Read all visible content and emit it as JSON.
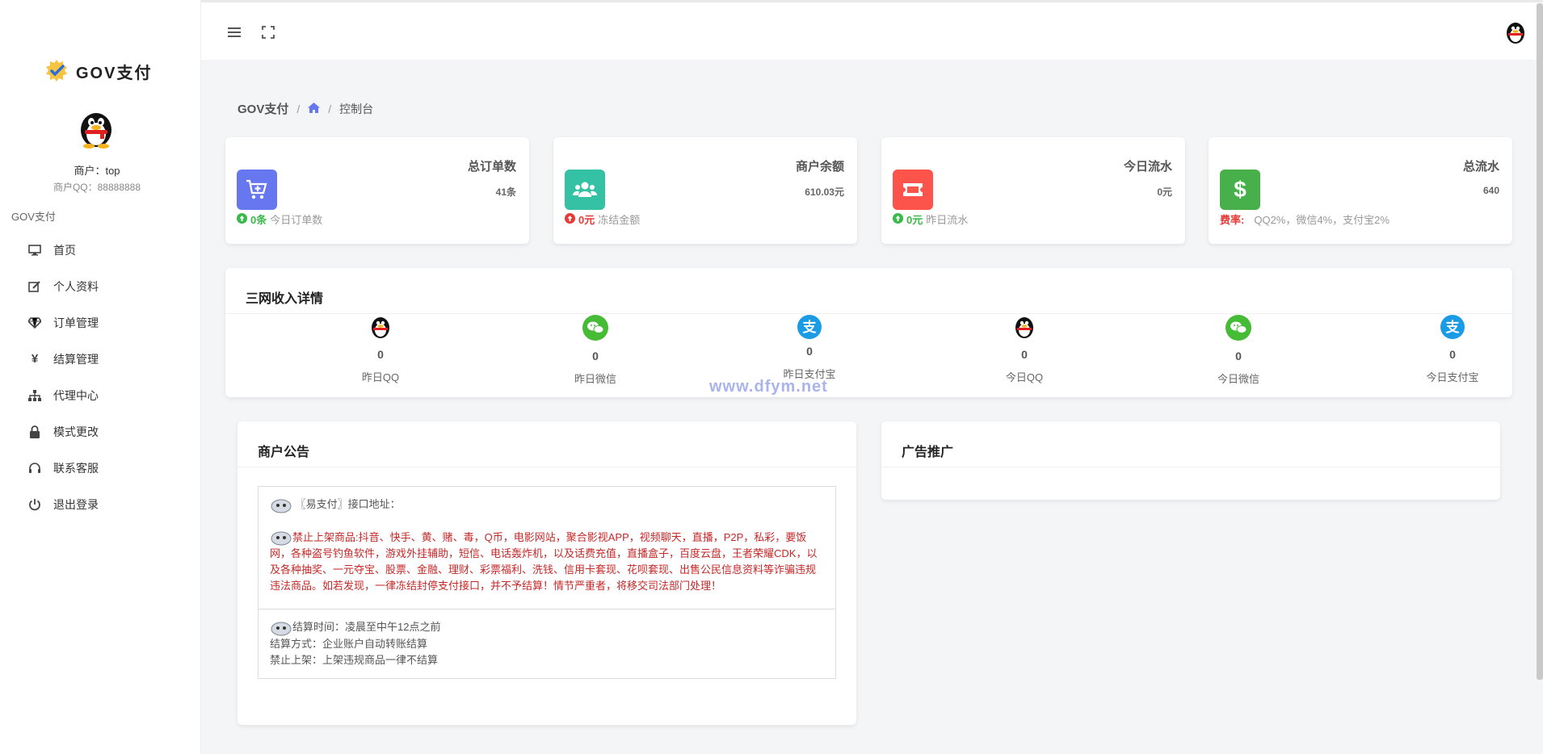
{
  "brand": {
    "name": "GOV支付"
  },
  "user": {
    "merchant_label": "商户：top",
    "qq_label": "商户QQ：88888888"
  },
  "nav": {
    "section": "GOV支付",
    "items": [
      {
        "label": "首页",
        "icon": "monitor-icon"
      },
      {
        "label": "个人资料",
        "icon": "edit-icon"
      },
      {
        "label": "订单管理",
        "icon": "diamond-icon"
      },
      {
        "label": "结算管理",
        "icon": "yen-icon"
      },
      {
        "label": "代理中心",
        "icon": "sitemap-icon"
      },
      {
        "label": "模式更改",
        "icon": "lock-icon"
      },
      {
        "label": "联系客服",
        "icon": "headset-icon"
      },
      {
        "label": "退出登录",
        "icon": "power-icon"
      }
    ]
  },
  "topbar": {
    "menu_icon": "hamburger-icon",
    "fullscreen_icon": "fullscreen-icon",
    "avatar_icon": "qq-penguin-icon"
  },
  "breadcrumb": {
    "root": "GOV支付",
    "sep1": "/",
    "home_icon": "home-icon",
    "sep2": "/",
    "current": "控制台"
  },
  "stats": [
    {
      "title": "总订单数",
      "value": "41条",
      "foot_value": "0条",
      "foot_label": "今日订单数",
      "foot_color": "green",
      "icon": "cart-add-icon",
      "color": "#6777ef"
    },
    {
      "title": "商户余额",
      "value": "610.03元",
      "foot_value": "0元",
      "foot_label": "冻结金额",
      "foot_color": "red",
      "icon": "users-icon",
      "color": "#35c2a4"
    },
    {
      "title": "今日流水",
      "value": "0元",
      "foot_value": "0元",
      "foot_label": "昨日流水",
      "foot_color": "green",
      "icon": "ticket-icon",
      "color": "#fc544b"
    },
    {
      "title": "总流水",
      "value": "640",
      "foot_value": "费率:",
      "foot_label": "QQ2%，微信4%，支付宝2%",
      "foot_color": "red",
      "icon": "dollar-icon",
      "color": "#47b04b"
    }
  ],
  "income": {
    "title": "三网收入详情",
    "items": [
      {
        "label": "昨日QQ",
        "value": "0",
        "icon": "qq-icon"
      },
      {
        "label": "昨日微信",
        "value": "0",
        "icon": "wechat-icon"
      },
      {
        "label": "昨日支付宝",
        "value": "0",
        "icon": "alipay-icon"
      },
      {
        "label": "今日QQ",
        "value": "0",
        "icon": "qq-icon"
      },
      {
        "label": "今日微信",
        "value": "0",
        "icon": "wechat-icon"
      },
      {
        "label": "今日支付宝",
        "value": "0",
        "icon": "alipay-icon"
      }
    ]
  },
  "notice": {
    "title": "商户公告",
    "line1": "〖易支付〗接口地址：",
    "line2": "禁止上架商品:抖音、快手、黄、赌、毒，Q币，电影网站，聚合影视APP，视频聊天，直播，P2P，私彩，要饭网，各种盗号钓鱼软件，游戏外挂辅助，短信、电话轰炸机，以及话费充值，直播盒子，百度云盘，王者荣耀CDK，以及各种抽奖、一元夺宝、股票、金融、理财、彩票福利、洗钱、信用卡套现、花呗套现、出售公民信息资料等诈骗违规违法商品。如若发现，一律冻结封停支付接口，并不予结算！情节严重者，将移交司法部门处理！",
    "line3": "结算时间：凌晨至中午12点之前",
    "line4": "结算方式：企业账户自动转账结算",
    "line5": "禁止上架：上架违规商品一律不结算"
  },
  "ads": {
    "title": "广告推广"
  },
  "watermark": "www.dfym.net"
}
